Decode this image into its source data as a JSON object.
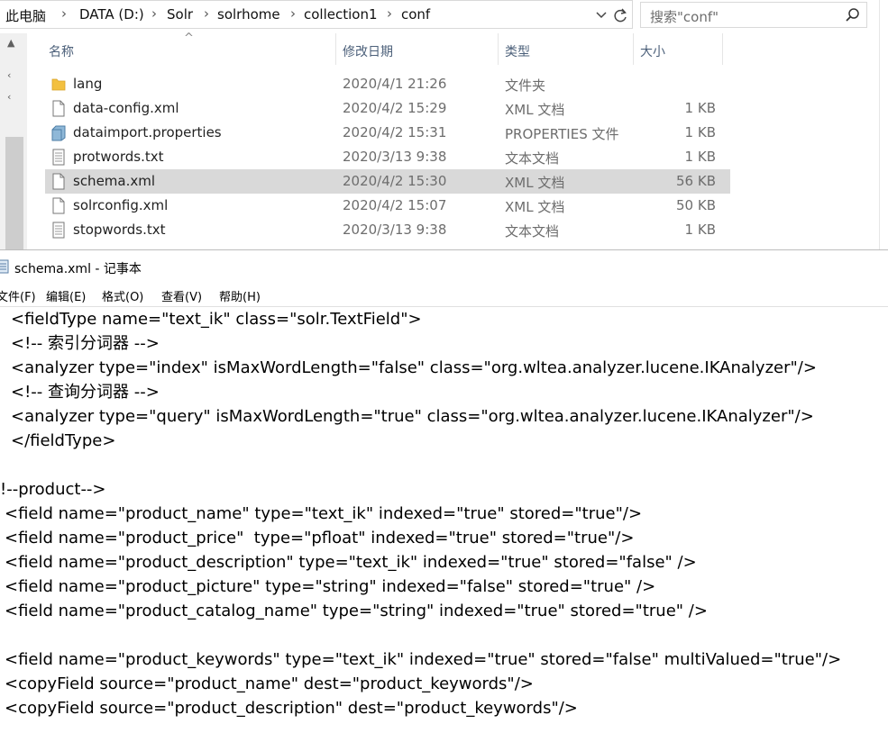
{
  "explorer": {
    "breadcrumb": [
      "此电脑",
      "DATA (D:)",
      "Solr",
      "solrhome",
      "collection1",
      "conf"
    ],
    "search_placeholder": "搜索\"conf\"",
    "columns": {
      "name": "名称",
      "date": "修改日期",
      "type": "类型",
      "size": "大小"
    },
    "files": [
      {
        "name": "lang",
        "date": "2020/4/1 21:26",
        "type": "文件夹",
        "size": "",
        "icon": "folder-icon"
      },
      {
        "name": "data-config.xml",
        "date": "2020/4/2 15:29",
        "type": "XML 文档",
        "size": "1 KB",
        "icon": "xml-file-icon"
      },
      {
        "name": "dataimport.properties",
        "date": "2020/4/2 15:31",
        "type": "PROPERTIES 文件",
        "size": "1 KB",
        "icon": "properties-file-icon"
      },
      {
        "name": "protwords.txt",
        "date": "2020/3/13 9:38",
        "type": "文本文档",
        "size": "1 KB",
        "icon": "text-file-icon"
      },
      {
        "name": "schema.xml",
        "date": "2020/4/2 15:30",
        "type": "XML 文档",
        "size": "56 KB",
        "icon": "xml-file-icon",
        "selected": true
      },
      {
        "name": "solrconfig.xml",
        "date": "2020/4/2 15:07",
        "type": "XML 文档",
        "size": "50 KB",
        "icon": "xml-file-icon"
      },
      {
        "name": "stopwords.txt",
        "date": "2020/3/13 9:38",
        "type": "文本文档",
        "size": "1 KB",
        "icon": "text-file-icon"
      }
    ]
  },
  "notepad": {
    "title": "schema.xml - 记事本",
    "menu": [
      "文件(F)",
      "编辑(E)",
      "格式(O)",
      "查看(V)",
      "帮助(H)"
    ],
    "lines": [
      "<fieldType name=\"text_ik\" class=\"solr.TextField\">",
      "<!-- 索引分词器 -->",
      "<analyzer type=\"index\" isMaxWordLength=\"false\" class=\"org.wltea.analyzer.lucene.IKAnalyzer\"/>",
      "<!-- 查询分词器 -->",
      "<analyzer type=\"query\" isMaxWordLength=\"true\" class=\"org.wltea.analyzer.lucene.IKAnalyzer\"/>",
      "</fieldType>",
      "",
      "!--product-->",
      "<field name=\"product_name\" type=\"text_ik\" indexed=\"true\" stored=\"true\"/>",
      "<field name=\"product_price\"  type=\"pfloat\" indexed=\"true\" stored=\"true\"/>",
      "<field name=\"product_description\" type=\"text_ik\" indexed=\"true\" stored=\"false\" />",
      "<field name=\"product_picture\" type=\"string\" indexed=\"false\" stored=\"true\" />",
      "<field name=\"product_catalog_name\" type=\"string\" indexed=\"true\" stored=\"true\" />",
      "",
      "<field name=\"product_keywords\" type=\"text_ik\" indexed=\"true\" stored=\"false\" multiValued=\"true\"/>",
      "<copyField source=\"product_name\" dest=\"product_keywords\"/>",
      "<copyField source=\"product_description\" dest=\"product_keywords\"/>"
    ]
  },
  "colors": {
    "selection": "#d9d9d9",
    "header_text": "#4c607a",
    "folder": "#f3c03f"
  }
}
